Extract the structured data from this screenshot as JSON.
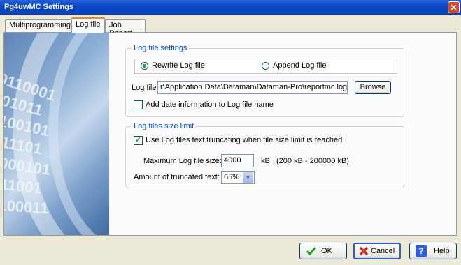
{
  "window": {
    "title": "Pg4uwMC Settings"
  },
  "tabs": [
    {
      "label": "Multiprogramming"
    },
    {
      "label": "Log file"
    },
    {
      "label": "Job Report"
    }
  ],
  "log_settings": {
    "title": "Log file settings",
    "rewrite_label": "Rewrite Log file",
    "append_label": "Append Log file",
    "selected_mode": "Rewrite Log file",
    "log_file_label": "Log file:",
    "log_file_value": "r\\Application Data\\Dataman\\Dataman-Pro\\reportmc.log",
    "browse_label": "Browse",
    "add_date_label": "Add date information to Log file name",
    "add_date_checked": false
  },
  "size_limit": {
    "title": "Log files size limit",
    "truncate_label": "Use Log files text truncating when file size limit is reached",
    "truncate_checked": true,
    "max_size_label": "Maximum Log file size:",
    "max_size_value": "4000",
    "max_size_unit": "kB   (200 kB - 200000 kB)",
    "amount_label": "Amount of truncated text:",
    "amount_value": "65%"
  },
  "footer": {
    "ok_label": "OK",
    "cancel_label": "Cancel",
    "help_label": "Help"
  },
  "colors": {
    "title_bar": "#0a46c8",
    "group_title": "#0046d5",
    "ok_icon": "#21a121",
    "cancel_icon": "#c0392b",
    "help_icon": "#2a5bd8"
  }
}
